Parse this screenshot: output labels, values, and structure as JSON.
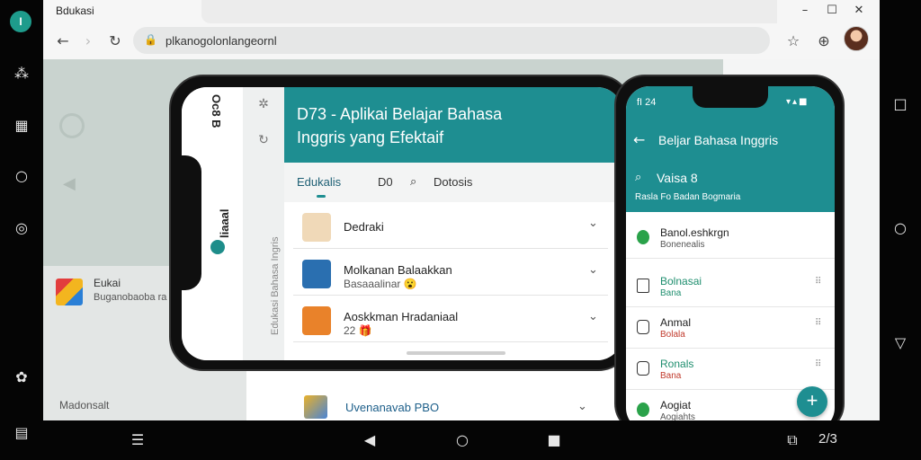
{
  "browser": {
    "title": "Bdukasi",
    "url": "plkanogolonlangeornl",
    "window_controls": [
      "–",
      "☐",
      "✕"
    ],
    "nav_icons": [
      "arrow-left-icon",
      "arrow-right-icon",
      "reload-icon",
      "lock-icon",
      "bookmark-star-icon",
      "extension-icon"
    ]
  },
  "left_rail": {
    "app_icon_letter": "I",
    "icons": [
      "share-icon",
      "grid-icon",
      "circle-icon",
      "record-icon",
      "settings-icon",
      "layout-icon"
    ]
  },
  "right_rail": {
    "icons": [
      "square-icon",
      "circle-icon",
      "triangle-down-icon"
    ]
  },
  "page": {
    "side_card": {
      "title": "Eukai",
      "subtitle": "Buganobaoba ra"
    },
    "footer_text": "Madonsalt"
  },
  "landscape_phone": {
    "rail_top_label": "Oc8 B",
    "rail_brand": "liaaal",
    "rail_gray_text": "Edukasi Bahasa Ingris",
    "header_title_line1": "D73 - Aplikai Belajar Bahasa",
    "header_title_line2": "Inggris yang Efektaif",
    "tabs": [
      {
        "label": "Edukalis",
        "active": true
      },
      {
        "label": "D0",
        "active": false
      },
      {
        "label": "Dotosis",
        "active": false
      }
    ],
    "rows": [
      {
        "title": "Dedraki",
        "subtitle": "",
        "thumb_color": "#f0d9b8"
      },
      {
        "title": "Molkanan Balaakkan",
        "subtitle": "Basaaalinar 😮",
        "thumb_color": "#2a6fb0"
      },
      {
        "title": "Aoskkman Hradaniaal",
        "subtitle": "22 🎁",
        "thumb_color": "#e9822a"
      }
    ]
  },
  "under_row": {
    "title": "Uvenanavab PBO"
  },
  "portrait_phone": {
    "status_time": "fI 24",
    "status_icons": "▾▴■",
    "title": "Beljar Bahasa Inggris",
    "search_label": "Vaisa 8",
    "subtitle": "Rasla Fo Badan Bogmaria",
    "rows": [
      {
        "title": "Banol.eshkrgn",
        "subtitle": "Bonenealis",
        "title_color": "#222222",
        "sub_color": "#555555",
        "icon": "leaf-icon"
      },
      {
        "title": "Bolnasai",
        "subtitle": "Bana",
        "title_color": "#1e8e6e",
        "sub_color": "#1e8e6e",
        "icon": "bookmark-icon"
      },
      {
        "title": "Anmal",
        "subtitle": "Bolala",
        "title_color": "#222222",
        "sub_color": "#c0392b",
        "icon": "note-icon"
      },
      {
        "title": "Ronals",
        "subtitle": "Bana",
        "title_color": "#1e8e6e",
        "sub_color": "#c0392b",
        "icon": "bookmark-icon"
      },
      {
        "title": "Aogiat",
        "subtitle": "Aogiahts",
        "title_color": "#222222",
        "sub_color": "#555555",
        "icon": "leaf-icon"
      }
    ],
    "fab_label": "+"
  },
  "bottom_nav": {
    "page_indicator": "2/3",
    "icons": [
      "menu-icon",
      "back-icon",
      "home-icon",
      "recents-icon",
      "screenshot-icon"
    ]
  },
  "colors": {
    "accent": "#1e8e91",
    "accent_dark": "#1d5f74"
  }
}
